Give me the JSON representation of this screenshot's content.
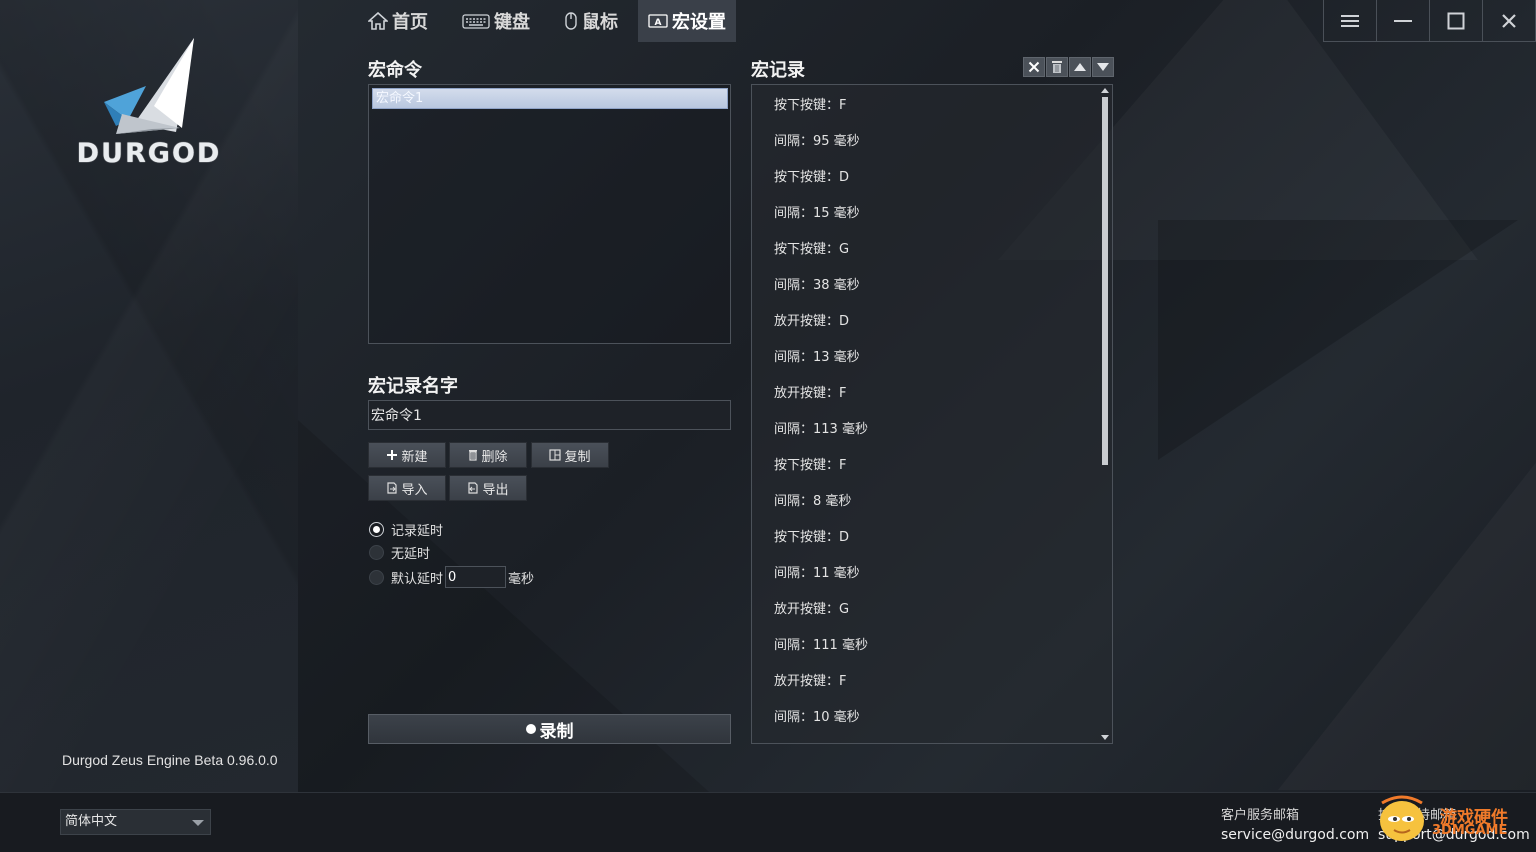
{
  "brand": {
    "logo_text": "DURGOD",
    "version": "Durgod Zeus Engine Beta 0.96.0.0"
  },
  "nav": {
    "tabs": [
      {
        "label": "首页",
        "icon": "home-icon"
      },
      {
        "label": "键盘",
        "icon": "keyboard-icon"
      },
      {
        "label": "鼠标",
        "icon": "mouse-icon"
      },
      {
        "label": "宏设置",
        "icon": "macro-icon",
        "active": true
      }
    ]
  },
  "window_controls": [
    "menu-icon",
    "minimize-icon",
    "maximize-icon",
    "close-icon"
  ],
  "macro_commands": {
    "title": "宏命令",
    "items": [
      "宏命令1"
    ],
    "selected": "宏命令1"
  },
  "macro_name": {
    "title": "宏记录名字",
    "value": "宏命令1"
  },
  "buttons": {
    "new": "新建",
    "delete": "删除",
    "copy": "复制",
    "import": "导入",
    "export": "导出",
    "record": "录制"
  },
  "delay_options": {
    "record_delay": "记录延时",
    "no_delay": "无延时",
    "default_delay": "默认延时",
    "default_delay_value": "0",
    "unit": "毫秒",
    "selected": "记录延时"
  },
  "macro_record": {
    "title": "宏记录",
    "tools": [
      "clear-icon",
      "trash-icon",
      "arrow-up-icon",
      "arrow-down-icon"
    ],
    "items": [
      "按下按键：F",
      "间隔：95 毫秒",
      "按下按键：D",
      "间隔：15 毫秒",
      "按下按键：G",
      "间隔：38 毫秒",
      "放开按键：D",
      "间隔：13 毫秒",
      "放开按键：F",
      "间隔：113 毫秒",
      "按下按键：F",
      "间隔：8 毫秒",
      "按下按键：D",
      "间隔：11 毫秒",
      "放开按键：G",
      "间隔：111 毫秒",
      "放开按键：F",
      "间隔：10 毫秒"
    ]
  },
  "footer": {
    "language": "简体中文",
    "service_email_label": "客户服务邮箱",
    "service_email": "service@durgod.com",
    "support_label": "技术支持邮箱",
    "support_email": "support@durgod.com",
    "watermark_line1": "游戏硬件",
    "watermark_line2": "3DMGAME"
  },
  "colors": {
    "active_tab": "#3a4049",
    "watermark": "#f07a2a",
    "logo_blue": "#4fa3d9"
  }
}
